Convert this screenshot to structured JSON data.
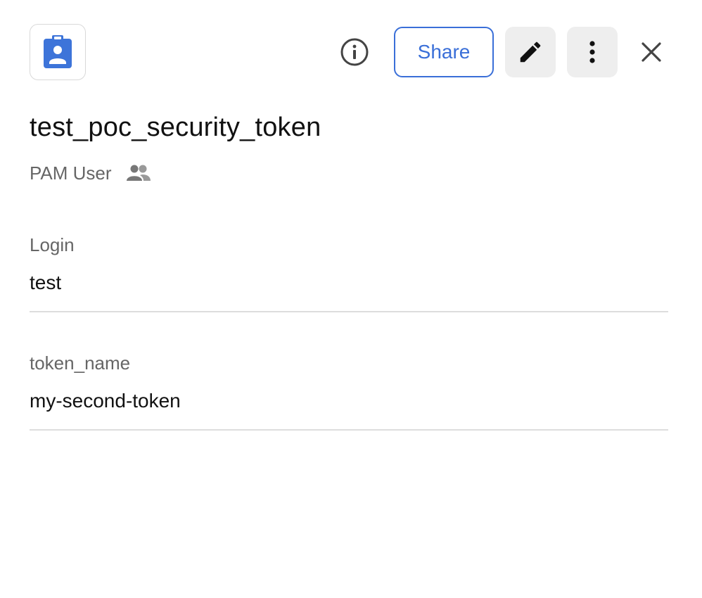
{
  "header": {
    "record_icon": "id-badge-icon",
    "info_icon": "info-circle-icon",
    "share_label": "Share",
    "edit_icon": "pencil-icon",
    "more_icon": "more-vertical-icon",
    "close_icon": "close-icon"
  },
  "record": {
    "title": "test_poc_security_token",
    "type": "PAM User",
    "shared_icon": "people-icon"
  },
  "fields": [
    {
      "label": "Login",
      "value": "test"
    },
    {
      "label": "token_name",
      "value": "my-second-token"
    }
  ],
  "colors": {
    "accent": "#3a6fd8",
    "icon_blue": "#3d74d9",
    "muted_text": "#666666",
    "button_bg": "#eeeeee",
    "divider": "#dddddd"
  }
}
